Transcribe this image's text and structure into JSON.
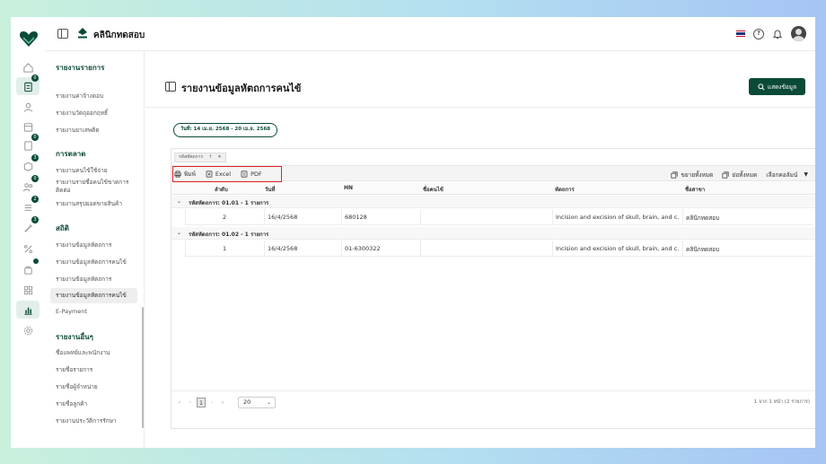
{
  "app": {
    "clinic_name": "คลินิกทดสอบ",
    "badges": [
      "0",
      "0",
      "3",
      "0",
      "2",
      "3"
    ]
  },
  "menu": {
    "sections": [
      {
        "title": "รายงานรายการ",
        "items": [
          "รายงานค่าจ้างตอบ",
          "รายงานวัตถุออกฤทธิ์",
          "รายงานยาเสพติด"
        ]
      },
      {
        "title": "การตลาด",
        "items": [
          "รายงานคนไข้ใช้จ่าย",
          "รายงานรายชื่อคนไข้ขาดการติดต่อ",
          "รายงานสรุปยอดขายสินค้า"
        ]
      },
      {
        "title": "สถิติ",
        "items": [
          "รายงานข้อมูลหัตถการ",
          "รายงานข้อมูลหัตถการคนไข้",
          "รายงานข้อมูลหัตถการ",
          "รายงานข้อมูลหัตถการคนไข้",
          "E-Payment"
        ]
      },
      {
        "title": "รายงานอื่นๆ",
        "items": [
          "ชื่อแพทย์และพนักงาน",
          "รายชื่อรายการ",
          "รายชื่อผู้จำหน่าย",
          "รายชื่อลูกค้า",
          "รายงานประวัติการรักษา"
        ]
      }
    ]
  },
  "page": {
    "title": "รายงานข้อมูลหัตถการคนไข้",
    "show_button": "แสดงข้อมูล",
    "date_range": "วันที่: 14 เม.ย. 2568 - 20 เม.ย. 2568"
  },
  "grid": {
    "group_chip": "รหัสหัตถการ",
    "toolbar": {
      "print": "พิมพ์",
      "excel": "Excel",
      "pdf": "PDF",
      "expand_all": "ขยายทั้งหมด",
      "collapse_all": "ย่อทั้งหมด",
      "choose_columns": "เลือกคอลัมน์"
    },
    "columns": [
      "ลำดับ",
      "วันที่",
      "HN",
      "ชื่อคนไข้",
      "หัตถการ",
      "ชื่อสาขา"
    ],
    "groups": [
      {
        "label": "รหัสหัตถการ: 01.01 - 1 รายการ",
        "rows": [
          {
            "no": "2",
            "date": "16/4/2568",
            "hn": "680128",
            "patient": "",
            "procedure": "Incision and excision of skull, brain, and c...",
            "branch": "คลินิกทดสอบ"
          }
        ]
      },
      {
        "label": "รหัสหัตถการ: 01.02 - 1 รายการ",
        "rows": [
          {
            "no": "1",
            "date": "16/4/2568",
            "hn": "01-6300322",
            "patient": "",
            "procedure": "Incision and excision of skull, brain, and c...",
            "branch": "คลินิกทดสอบ"
          }
        ]
      }
    ],
    "footer": {
      "current_page": "1",
      "page_size": "20",
      "summary": "1 จาก 1 หน้า (2 รายการ)"
    }
  },
  "colors": {
    "brand": "#0b4a39",
    "highlight": "#e02424"
  }
}
